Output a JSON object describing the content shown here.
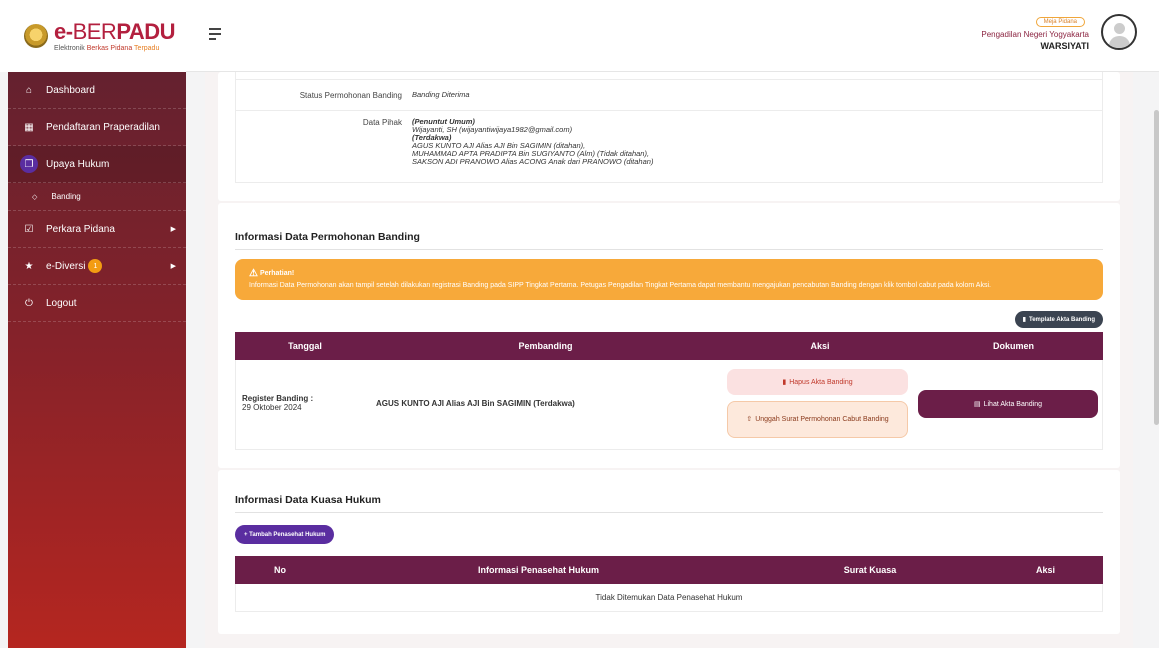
{
  "brand": {
    "name_e": "e-",
    "name_ber": "BER",
    "name_padu": "PADU",
    "tagline_1": "Elektronik ",
    "tagline_2": "Berkas Pidana ",
    "tagline_3": "Terpadu"
  },
  "header": {
    "role_badge": "Meja Pidana",
    "court_name": "Pengadilan Negeri Yogyakarta",
    "user_name": "WARSIYATI"
  },
  "sidebar": {
    "items": [
      {
        "label": "Dashboard",
        "icon": "home-icon"
      },
      {
        "label": "Pendaftaran Praperadilan",
        "icon": "file-icon"
      },
      {
        "label": "Upaya Hukum",
        "icon": "file-copy-icon"
      },
      {
        "label": "Banding",
        "icon": "diamond-icon"
      },
      {
        "label": "Perkara Pidana",
        "icon": "checkbox-icon"
      },
      {
        "label": "e-Diversi",
        "icon": "star-icon",
        "badge": "1"
      },
      {
        "label": "Logout",
        "icon": "power-icon"
      }
    ]
  },
  "detail": {
    "status_label": "Status Permohonan Banding",
    "status_value": "Banding Diterima",
    "pihak_label": "Data Pihak",
    "pihak_lines": [
      "(Penuntut Umum)",
      "Wijayanti, SH (wijayantiwijaya1982@gmail.com)",
      "(Terdakwa)",
      "AGUS KUNTO AJI Alias AJI Bin SAGIMIN (ditahan),",
      "MUHAMMAD APTA PRADIPTA Bin SUGIYANTO (Alm) (Tidak ditahan),",
      "SAKSON ADI PRANOWO Alias ACONG Anak dari PRANOWO (ditahan)"
    ]
  },
  "permohonan": {
    "title": "Informasi Data Permohonan Banding",
    "alert_title": "Perhatian!",
    "alert_text": "Informasi Data Permohonan akan tampil setelah dilakukan registrasi Banding pada SIPP Tingkat Pertama. Petugas Pengadilan Tingkat Pertama dapat membantu mengajukan pencabutan Banding dengan klik tombol cabut pada kolom Aksi.",
    "template_button": "Template Akta Banding",
    "columns": [
      "Tanggal",
      "Pembanding",
      "Aksi",
      "Dokumen"
    ],
    "row": {
      "tanggal_label": "Register Banding :",
      "tanggal_value": "29 Oktober 2024",
      "pembanding": "AGUS KUNTO AJI Alias AJI Bin SAGIMIN (Terdakwa)",
      "hapus_button": "Hapus Akta Banding",
      "unggah_button": "Unggah Surat Permohonan Cabut Banding",
      "lihat_button": "Lihat Akta Banding"
    }
  },
  "kuasa": {
    "title": "Informasi Data Kuasa Hukum",
    "add_button": "+ Tambah Penasehat Hukum",
    "columns": [
      "No",
      "Informasi Penasehat Hukum",
      "Surat Kuasa",
      "Aksi"
    ],
    "empty_text": "Tidak Ditemukan Data Penasehat Hukum"
  },
  "colors": {
    "primary": "#6b1e48",
    "accent": "#5a2da0",
    "warning": "#f7a93a",
    "danger": "#c0392b"
  }
}
